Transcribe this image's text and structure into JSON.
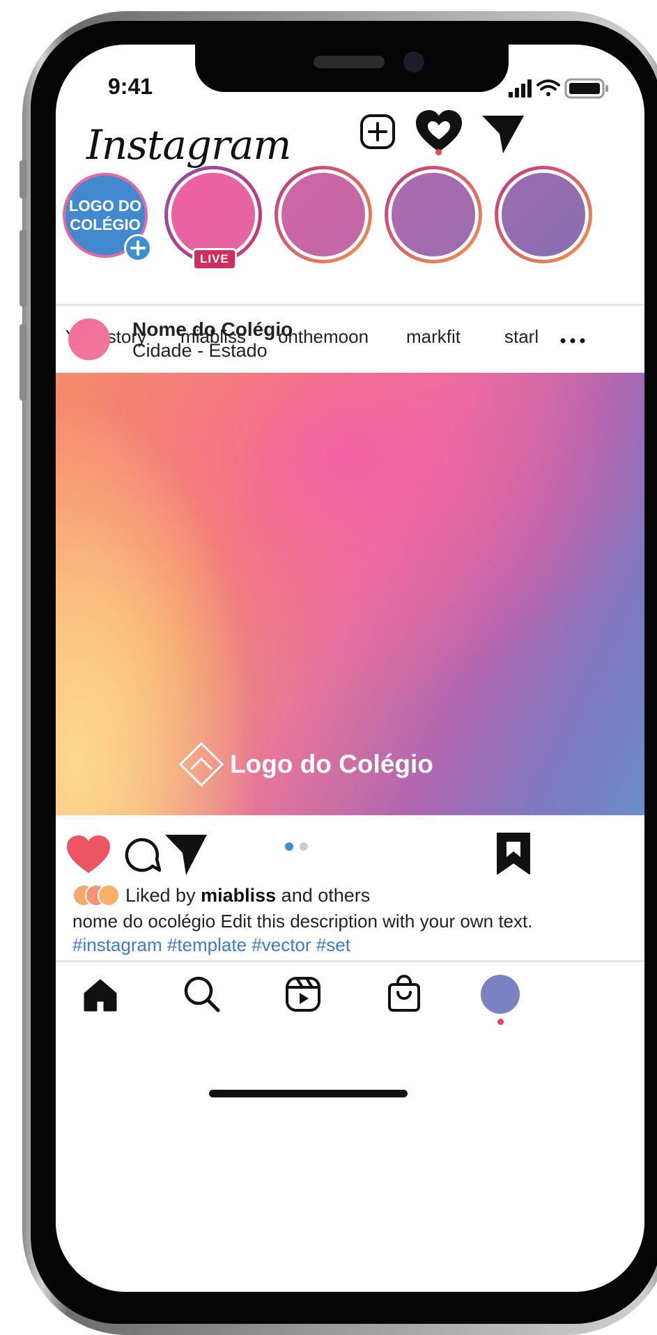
{
  "status_bar": {
    "time": "9:41"
  },
  "header": {
    "app_name": "Instagram"
  },
  "stories": [
    {
      "label": "Your story",
      "avatar_text": "LOGO DO COLÉGIO"
    },
    {
      "label": "miabliss",
      "badge": "LIVE"
    },
    {
      "label": "onthemoon"
    },
    {
      "label": "markfit"
    },
    {
      "label": "starl"
    }
  ],
  "post": {
    "account_name": "Nome do Colégio",
    "location": "Cidade - Estado",
    "image_logo_text": "Logo do Colégio",
    "carousel": {
      "count": 2,
      "current": 1
    },
    "liked_prefix": "Liked by",
    "liked_user": "miabliss",
    "liked_suffix": "and others",
    "description": "nome do ocolégio Edit this description with your own text.",
    "hashtags": [
      "#instagram",
      "#template",
      "#vector",
      "#set"
    ]
  },
  "colors": {
    "accent_blue": "#3d7bc7",
    "heart_red": "#ee5563",
    "live_badge": "#d22c5b",
    "notification_dot": "#e8455d"
  },
  "icons": {
    "create": "plus-square-icon",
    "activity": "heart-icon",
    "direct": "paper-plane-icon",
    "like": "heart-icon",
    "comment": "speech-bubble-icon",
    "share": "paper-plane-icon",
    "save": "bookmark-icon",
    "nav": [
      "home-icon",
      "search-icon",
      "reels-icon",
      "shop-icon",
      "profile-avatar"
    ]
  }
}
